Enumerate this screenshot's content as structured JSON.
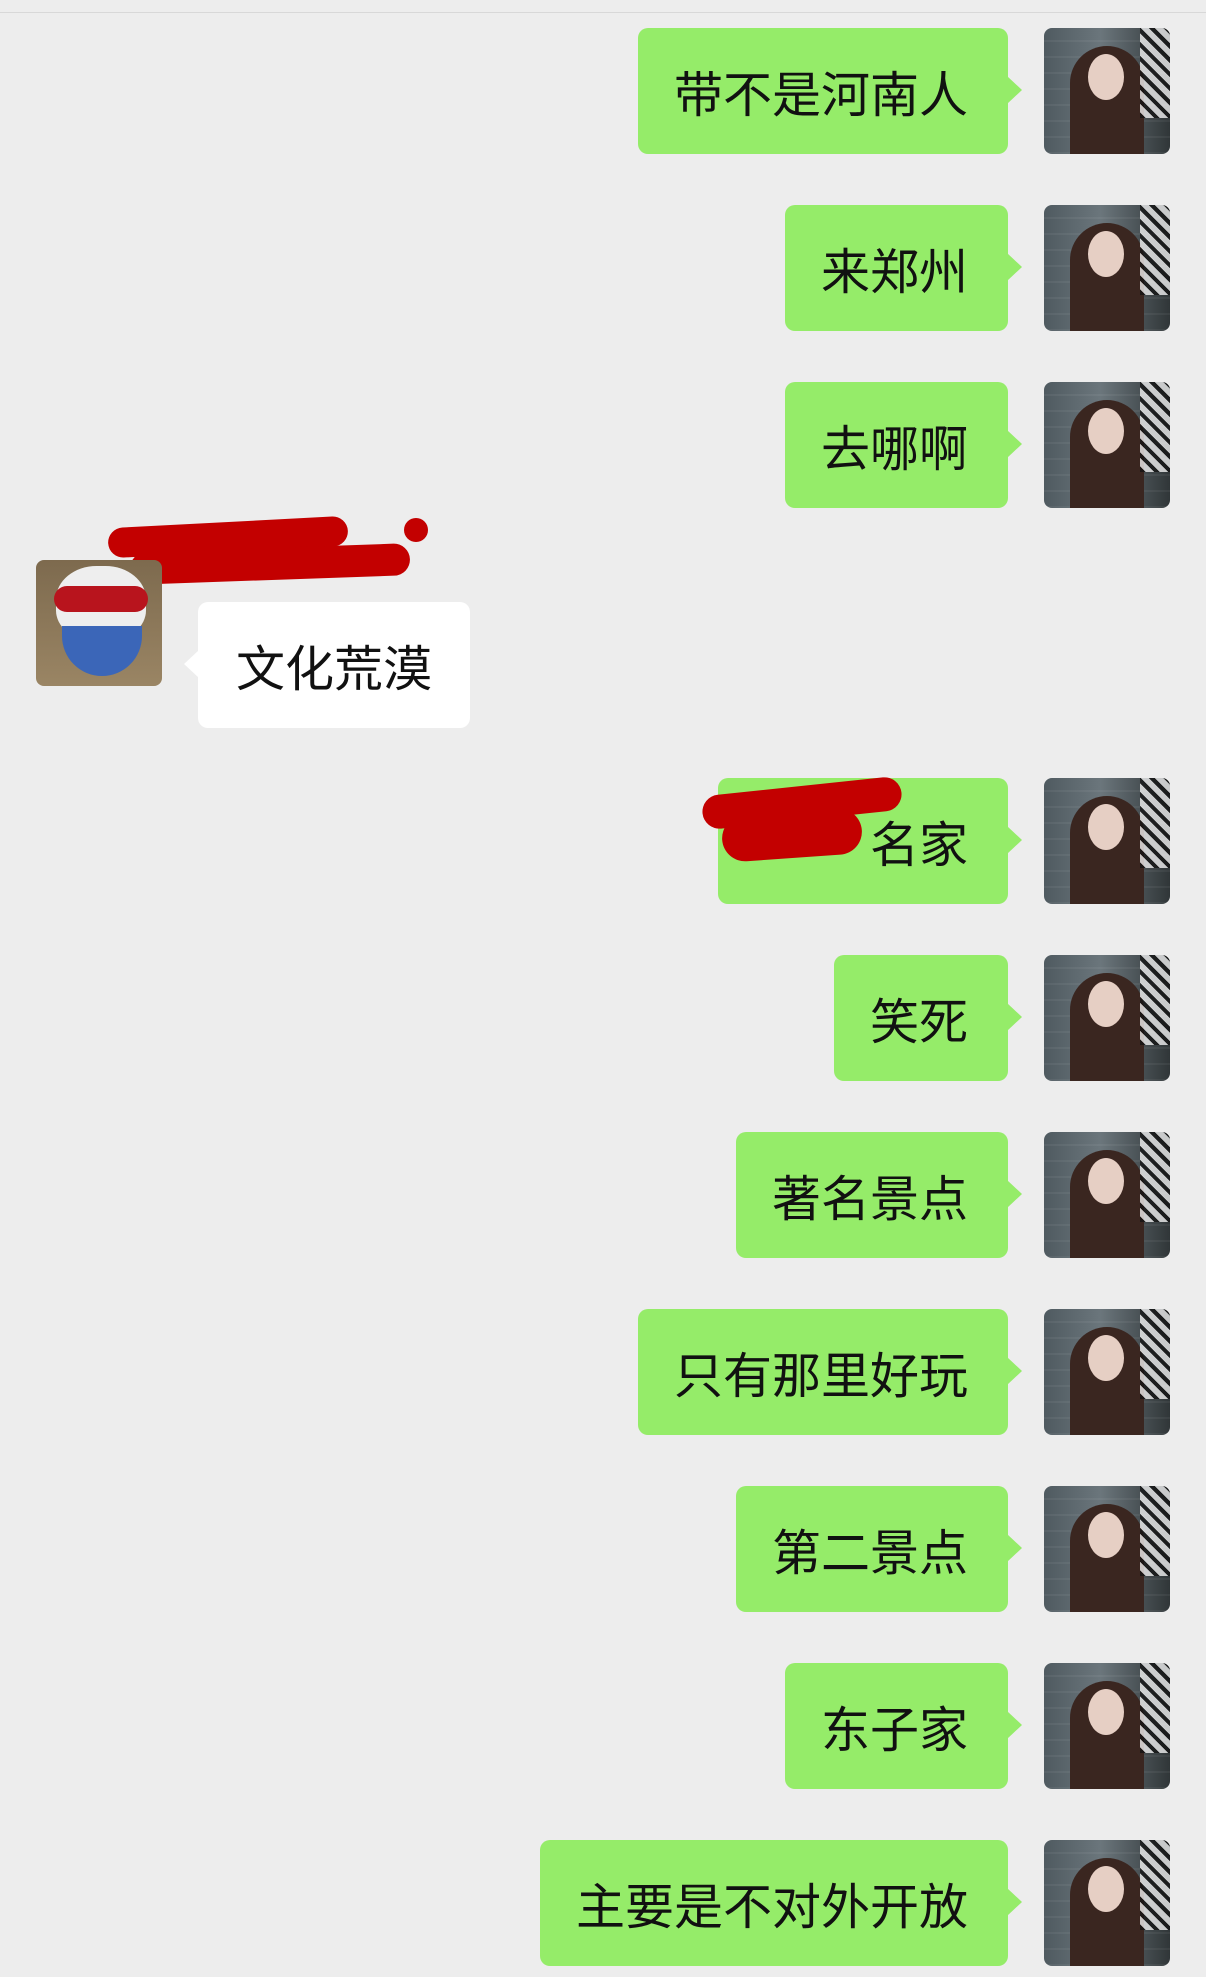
{
  "conversation": {
    "messages": [
      {
        "side": "me",
        "text": "带不是河南人"
      },
      {
        "side": "me",
        "text": "来郑州"
      },
      {
        "side": "me",
        "text": "去哪啊"
      },
      {
        "side": "them",
        "text": "文化荒漠"
      },
      {
        "side": "me",
        "text": "名家"
      },
      {
        "side": "me",
        "text": "笑死"
      },
      {
        "side": "me",
        "text": "著名景点"
      },
      {
        "side": "me",
        "text": "只有那里好玩"
      },
      {
        "side": "me",
        "text": "第二景点"
      },
      {
        "side": "me",
        "text": "东子家"
      },
      {
        "side": "me",
        "text": "主要是不对外开放"
      }
    ]
  },
  "colors": {
    "background": "#ededed",
    "sent_bubble": "#95ec69",
    "received_bubble": "#ffffff",
    "redaction": "#c30000"
  },
  "icons": {
    "my_avatar": "woman-avatar",
    "their_avatar": "masked-cat-avatar"
  }
}
